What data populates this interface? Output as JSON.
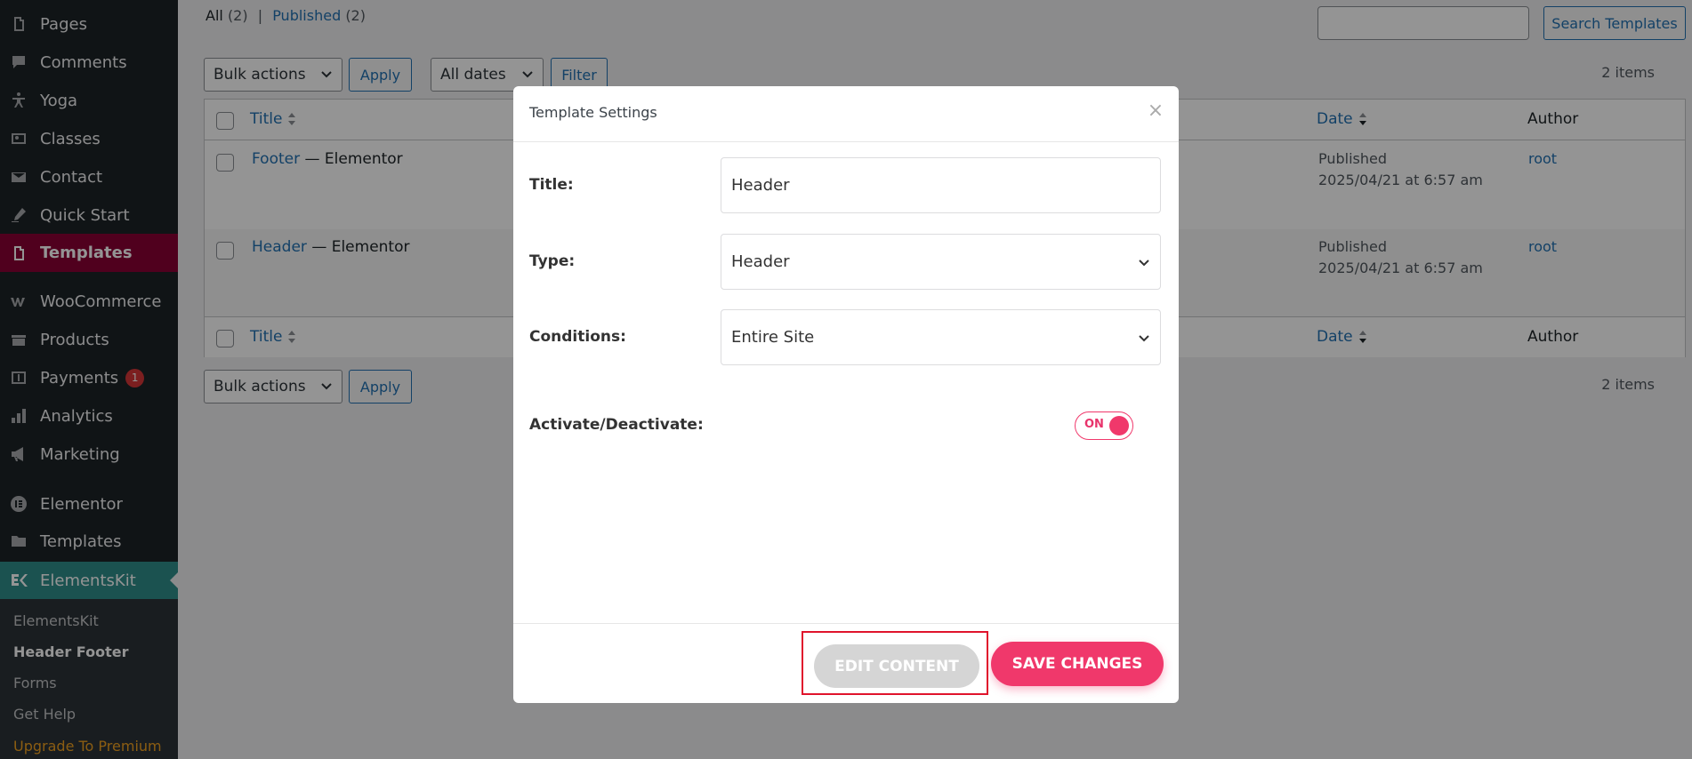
{
  "sidebar": {
    "items": [
      {
        "label": "Pages",
        "icon": "pages-icon"
      },
      {
        "label": "Comments",
        "icon": "comments-icon"
      },
      {
        "label": "Yoga",
        "icon": "yoga-icon"
      },
      {
        "label": "Classes",
        "icon": "classes-icon"
      },
      {
        "label": "Contact",
        "icon": "mail-icon"
      },
      {
        "label": "Quick Start",
        "icon": "quick-start-icon"
      },
      {
        "label": "Templates",
        "icon": "templates-icon"
      },
      {
        "label": "WooCommerce",
        "icon": "woocommerce-icon"
      },
      {
        "label": "Products",
        "icon": "products-icon"
      },
      {
        "label": "Payments",
        "icon": "payments-icon",
        "badge": "1"
      },
      {
        "label": "Analytics",
        "icon": "analytics-icon"
      },
      {
        "label": "Marketing",
        "icon": "marketing-icon"
      },
      {
        "label": "Elementor",
        "icon": "elementor-icon"
      },
      {
        "label": "Templates",
        "icon": "folder-icon"
      },
      {
        "label": "ElementsKit",
        "icon": "elementskit-icon"
      }
    ],
    "submenu": [
      "ElementsKit",
      "Header Footer",
      "Forms",
      "Get Help",
      "Upgrade To Premium"
    ]
  },
  "filters": {
    "all_label": "All",
    "all_count": "(2)",
    "separator": "|",
    "published_label": "Published",
    "published_count": "(2)"
  },
  "search": {
    "button_label": "Search Templates",
    "value": ""
  },
  "toolbar": {
    "bulk_actions": "Bulk actions",
    "apply": "Apply",
    "all_dates": "All dates",
    "filter": "Filter",
    "items_count": "2 items"
  },
  "table": {
    "columns": {
      "title": "Title",
      "date": "Date",
      "author": "Author"
    },
    "rows": [
      {
        "title": "Footer",
        "suffix": "— Elementor",
        "status": "Published",
        "date": "2025/04/21 at 6:57 am",
        "author": "root"
      },
      {
        "title": "Header",
        "suffix": "— Elementor",
        "status": "Published",
        "date": "2025/04/21 at 6:57 am",
        "author": "root"
      }
    ]
  },
  "modal": {
    "title": "Template Settings",
    "close": "×",
    "title_label": "Title:",
    "title_value": "Header",
    "type_label": "Type:",
    "type_value": "Header",
    "conditions_label": "Conditions:",
    "conditions_value": "Entire Site",
    "activate_label": "Activate/Deactivate:",
    "toggle_label": "ON",
    "edit_content": "EDIT CONTENT",
    "save_changes": "SAVE CHANGES"
  },
  "colors": {
    "accent": "#f0386b",
    "wp_link": "#2271b1",
    "sidebar_bg": "#1d2327",
    "active_menu": "#8a0035",
    "elementskit_menu": "#2f8e8a",
    "highlight_box": "#e0142c"
  }
}
